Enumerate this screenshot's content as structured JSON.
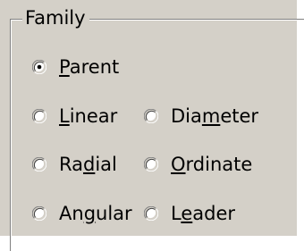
{
  "group": {
    "title": "Family"
  },
  "options": [
    {
      "pre": "",
      "key": "P",
      "post": "arent",
      "selected": true
    },
    {
      "pre": "",
      "key": "L",
      "post": "inear",
      "selected": false
    },
    {
      "pre": "Dia",
      "key": "m",
      "post": "eter",
      "selected": false
    },
    {
      "pre": "Ra",
      "key": "d",
      "post": "ial",
      "selected": false
    },
    {
      "pre": "",
      "key": "O",
      "post": "rdinate",
      "selected": false
    },
    {
      "pre": "An",
      "key": "g",
      "post": "ular",
      "selected": false
    },
    {
      "pre": "L",
      "key": "e",
      "post": "ader",
      "selected": false
    }
  ],
  "colors": {
    "face": "#d4d0c8",
    "shadow": "#808080",
    "dark_shadow": "#404040",
    "highlight": "#ffffff",
    "text": "#000000"
  }
}
